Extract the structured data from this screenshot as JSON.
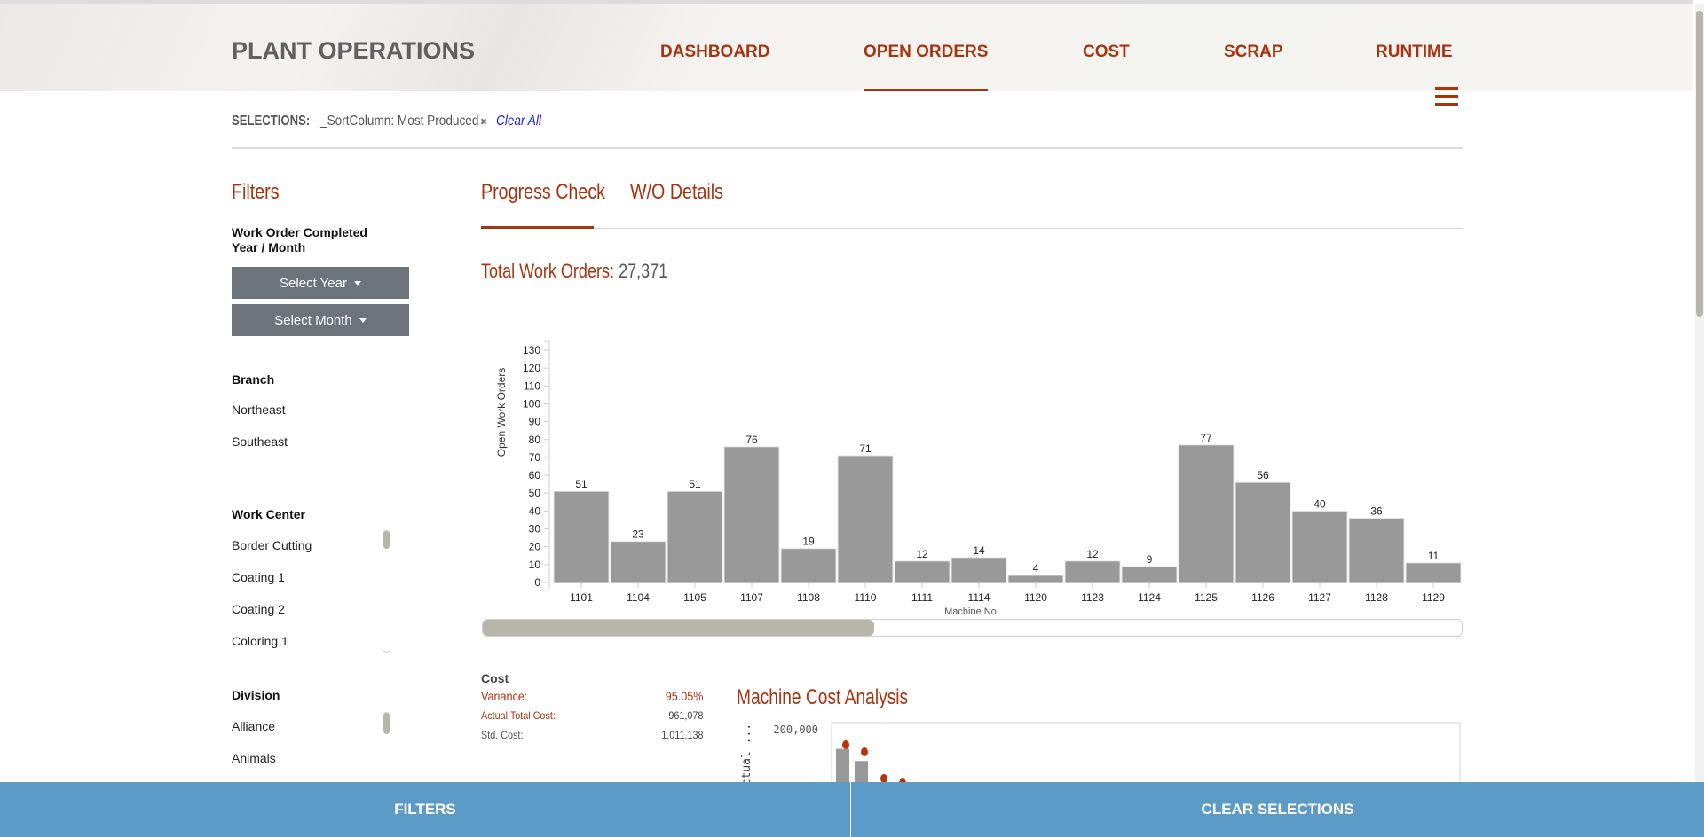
{
  "header": {
    "brand": "PLANT OPERATIONS",
    "nav": [
      {
        "label": "DASHBOARD",
        "active": false
      },
      {
        "label": "OPEN ORDERS",
        "active": true
      },
      {
        "label": "COST",
        "active": false
      },
      {
        "label": "SCRAP",
        "active": false
      },
      {
        "label": "RUNTIME",
        "active": false
      }
    ],
    "menu_icon": "hamburger-icon"
  },
  "selections": {
    "label": "SELECTIONS:",
    "chips": [
      {
        "text": "_SortColumn: Most Produced",
        "remove_icon": "close-icon"
      }
    ],
    "clear_all": "Clear All"
  },
  "filters": {
    "heading": "Filters",
    "date_group": {
      "title_line1": "Work Order Completed",
      "title_line2": "Year / Month",
      "year_button": "Select Year",
      "month_button": "Select Month"
    },
    "branch": {
      "title": "Branch",
      "options": [
        "Northeast",
        "Southeast"
      ]
    },
    "work_center": {
      "title": "Work Center",
      "options": [
        "Border Cutting",
        "Coating 1",
        "Coating 2",
        "Coloring 1"
      ]
    },
    "division": {
      "title": "Division",
      "options": [
        "Alliance",
        "Animals"
      ]
    }
  },
  "tabs": [
    {
      "label": "Progress Check",
      "active": true
    },
    {
      "label": "W/O Details",
      "active": false
    }
  ],
  "summary": {
    "total_label": "Total Work Orders:",
    "total_value": "27,371"
  },
  "chart_data": [
    {
      "type": "bar",
      "title": "",
      "xlabel": "Machine No.",
      "ylabel": "Open Work Orders",
      "categories": [
        "1101",
        "1104",
        "1105",
        "1107",
        "1108",
        "1110",
        "1111",
        "1114",
        "1120",
        "1123",
        "1124",
        "1125",
        "1126",
        "1127",
        "1128",
        "1129"
      ],
      "values": [
        51,
        23,
        51,
        76,
        19,
        71,
        12,
        14,
        4,
        12,
        9,
        77,
        56,
        40,
        36,
        11
      ],
      "ylim": [
        0,
        130
      ],
      "yticks": [
        0,
        10,
        20,
        30,
        40,
        50,
        60,
        70,
        80,
        90,
        100,
        110,
        120,
        130
      ],
      "data_labels": true,
      "grid": false,
      "bar_color": "#999999",
      "scroll_visible_fraction": 0.4
    },
    {
      "type": "bar",
      "title": "Machine Cost Analysis",
      "ylabel": "Actual ...",
      "yticks_visible": [
        "200,000"
      ],
      "partial": true,
      "bar_color": "#999999",
      "marker_color": "#b93407"
    }
  ],
  "cost": {
    "title": "Cost",
    "rows": [
      {
        "label": "Variance:",
        "value": "95.05%"
      },
      {
        "label": "Actual Total Cost:",
        "value": "961,078"
      },
      {
        "label": "Std. Cost:",
        "value": "1,011,138"
      }
    ]
  },
  "footer": {
    "filters_button": "FILTERS",
    "clear_button": "CLEAR SELECTIONS"
  },
  "colors": {
    "accent": "#a8330f",
    "footer": "#5b9bc6",
    "button_gray": "#6c737b",
    "bar_gray": "#999999",
    "link_blue": "#1a1adc"
  }
}
